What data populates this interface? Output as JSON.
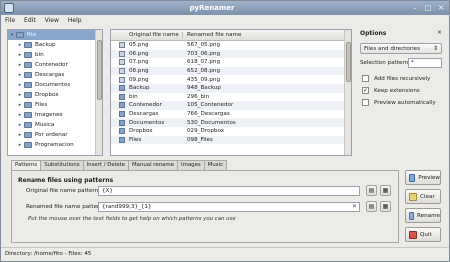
{
  "window": {
    "title": "pyRenamer"
  },
  "menu": [
    "File",
    "Edit",
    "View",
    "Help"
  ],
  "tree": {
    "root": "fito",
    "items": [
      "Backup",
      "bin",
      "Contenedor",
      "Descargas",
      "Documentos",
      "Dropbox",
      "Files",
      "Imagenes",
      "Musica",
      "Por ordenar",
      "Programacion"
    ]
  },
  "files": {
    "headers": {
      "original": "Original file name",
      "renamed": "Renamed file name"
    },
    "rows": [
      {
        "original": "05.png",
        "renamed": "567_05.png",
        "dir": false
      },
      {
        "original": "06.png",
        "renamed": "703_06.png",
        "dir": false
      },
      {
        "original": "07.png",
        "renamed": "618_07.png",
        "dir": false
      },
      {
        "original": "08.png",
        "renamed": "652_08.png",
        "dir": false
      },
      {
        "original": "09.png",
        "renamed": "435_09.png",
        "dir": false
      },
      {
        "original": "Backup",
        "renamed": "948_Backup",
        "dir": true
      },
      {
        "original": "bin",
        "renamed": "296_bin",
        "dir": true
      },
      {
        "original": "Contenedor",
        "renamed": "105_Contenedor",
        "dir": true
      },
      {
        "original": "Descargas",
        "renamed": "766_Descargas",
        "dir": true
      },
      {
        "original": "Documentos",
        "renamed": "530_Documentos",
        "dir": true
      },
      {
        "original": "Dropbox",
        "renamed": "029_Dropbox",
        "dir": true
      },
      {
        "original": "Files",
        "renamed": "098_Files",
        "dir": true
      }
    ]
  },
  "options": {
    "title": "Options",
    "close": "×",
    "filter": "Files and directories",
    "selection_label": "Selection pattern",
    "selection_value": "*",
    "recursive": {
      "label": "Add files recursively",
      "checked": false
    },
    "keep_ext": {
      "label": "Keep extensions",
      "checked": true
    },
    "auto_preview": {
      "label": "Preview automatically",
      "checked": false
    }
  },
  "tabs": [
    "Patterns",
    "Substitutions",
    "Insert / Delete",
    "Manual rename",
    "Images",
    "Music"
  ],
  "patterns": {
    "title": "Rename files using patterns",
    "original_label": "Original file name pattern",
    "original_value": "{X}",
    "renamed_label": "Renamed file name pattern",
    "renamed_value": "{rand999;3}_{1}",
    "hint": "Put the mouse over the text fields to get help on which patterns you can use"
  },
  "actions": {
    "preview": "Preview",
    "clear": "Clear",
    "rename": "Rename",
    "quit": "Quit"
  },
  "status": "Directory: /home/fito - Files: 45",
  "colors": {
    "selection": "#8aa7cb",
    "titlebar": "#7b92ad"
  }
}
